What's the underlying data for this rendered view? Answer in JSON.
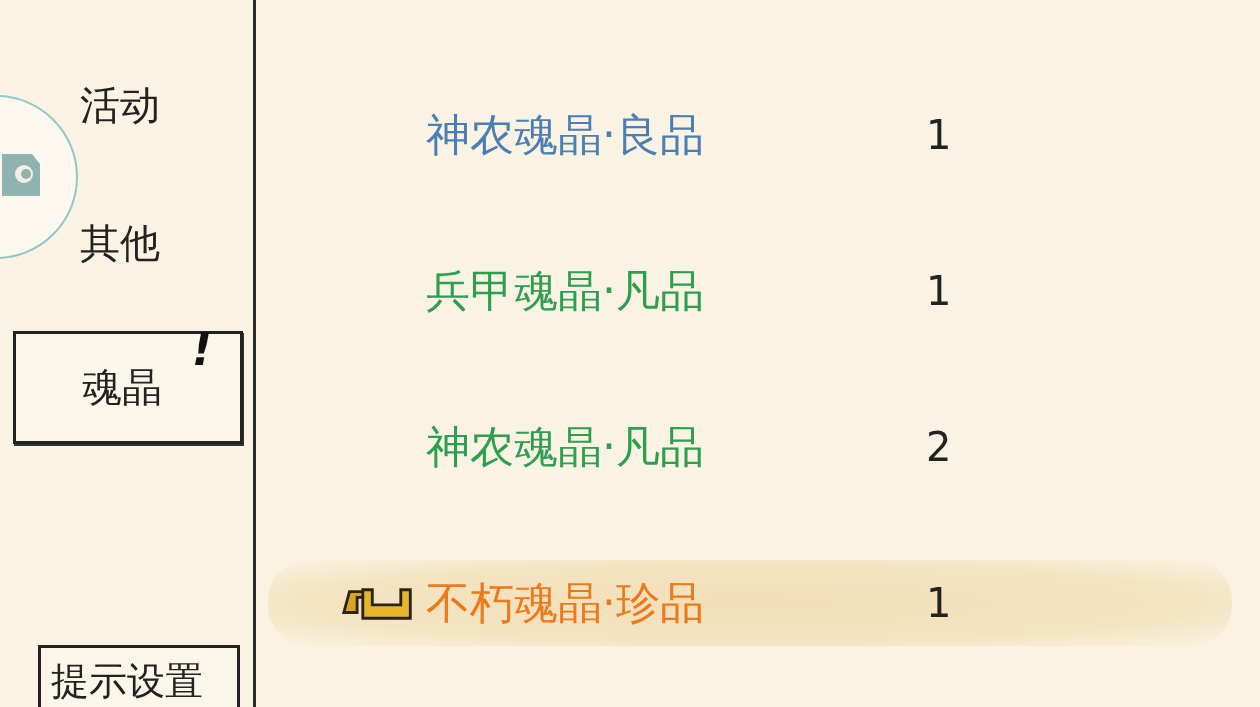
{
  "sidebar": {
    "items": [
      {
        "label": "活动",
        "selected": false
      },
      {
        "label": "其他",
        "selected": false
      },
      {
        "label": "魂晶",
        "selected": true,
        "badge": "!"
      }
    ],
    "settings_button": "提示设置"
  },
  "items": [
    {
      "name": "神农魂晶·良品",
      "color": "#4a7fb5",
      "count": "1",
      "selected": false,
      "equipped": false
    },
    {
      "name": "兵甲魂晶·凡品",
      "color": "#2e9e4f",
      "count": "1",
      "selected": false,
      "equipped": false
    },
    {
      "name": "神农魂晶·凡品",
      "color": "#2e9e4f",
      "count": "2",
      "selected": false,
      "equipped": false
    },
    {
      "name": "不朽魂晶·珍品",
      "color": "#ec7a1c",
      "count": "1",
      "selected": true,
      "equipped": true
    }
  ]
}
